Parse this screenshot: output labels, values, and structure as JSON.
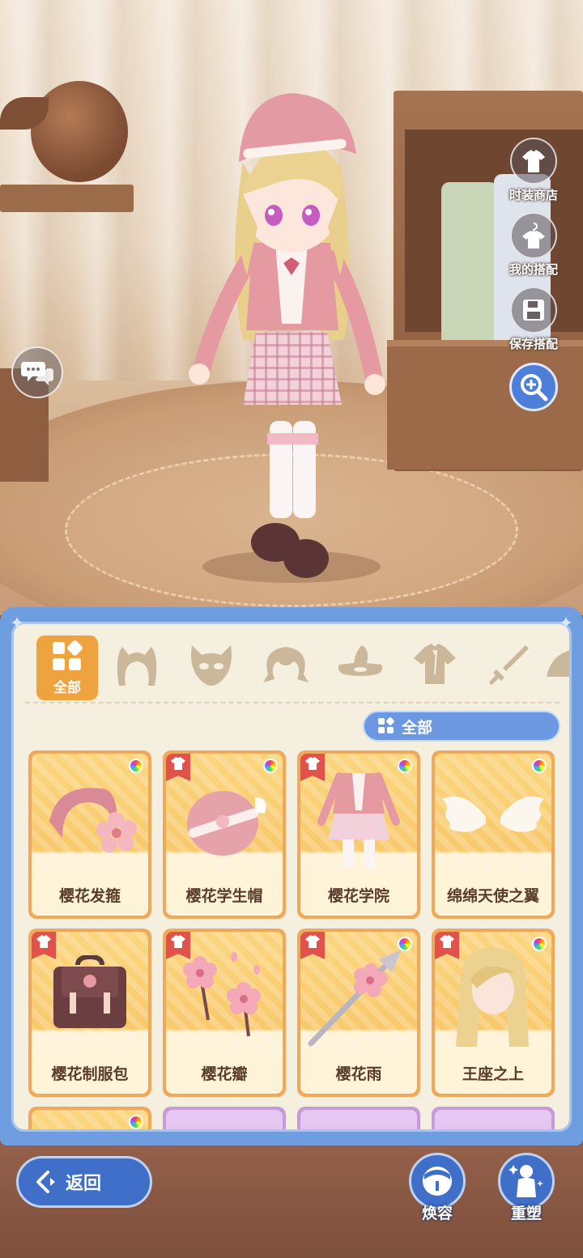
{
  "scene_buttons": {
    "fashion_shop": "时装商店",
    "my_outfits": "我的搭配",
    "save_outfit": "保存搭配"
  },
  "categories": {
    "active_label": "全部",
    "items": [
      "hairband-icon",
      "mask-icon",
      "hair-icon",
      "hat-icon",
      "top-icon",
      "weapon-icon",
      "wing-icon"
    ]
  },
  "filter": {
    "label": "全部"
  },
  "items": [
    {
      "name": "樱花发箍",
      "dyeable": true,
      "tagged": false
    },
    {
      "name": "樱花学生帽",
      "dyeable": true,
      "tagged": true
    },
    {
      "name": "樱花学院",
      "dyeable": true,
      "tagged": true
    },
    {
      "name": "绵绵天使之翼",
      "dyeable": true,
      "tagged": false
    },
    {
      "name": "樱花制服包",
      "dyeable": false,
      "tagged": true
    },
    {
      "name": "樱花瓣",
      "dyeable": false,
      "tagged": true
    },
    {
      "name": "樱花雨",
      "dyeable": true,
      "tagged": true
    },
    {
      "name": "王座之上",
      "dyeable": true,
      "tagged": true
    }
  ],
  "bottom": {
    "back_label": "返回",
    "makeover_label": "焕容",
    "reshape_label": "重塑"
  },
  "colors": {
    "panel_blue": "#6f9ee0",
    "active_orange": "#eea33e",
    "card_border": "#f0a95a",
    "tag_red": "#e0524a"
  }
}
